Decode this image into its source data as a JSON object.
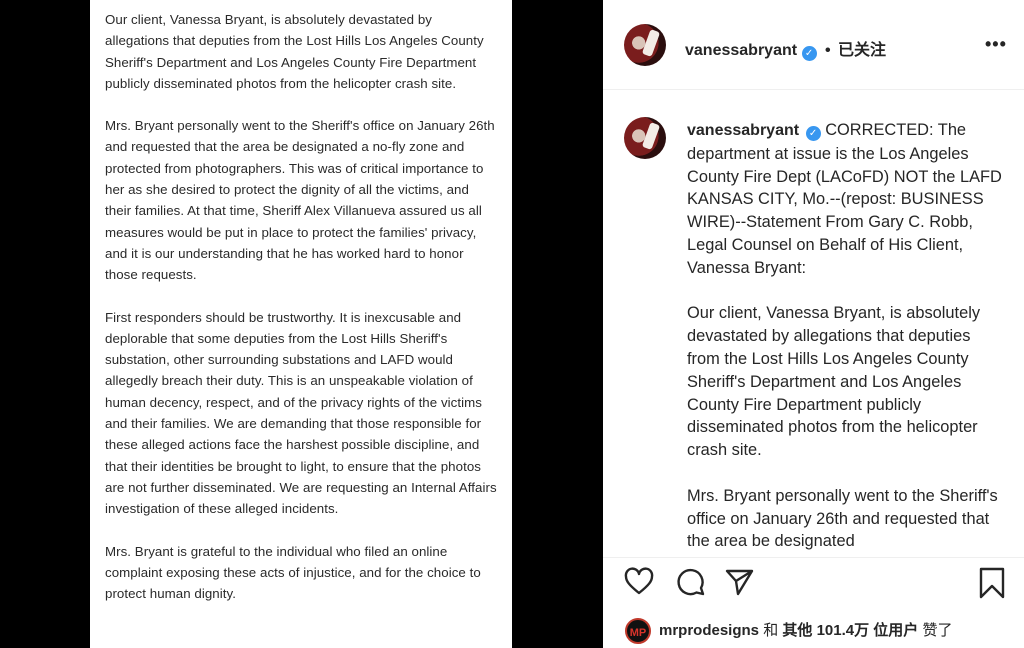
{
  "statement": {
    "paragraphs": [
      "Our client, Vanessa Bryant, is absolutely devastated by allegations that deputies from the Lost Hills Los Angeles County Sheriff's Department and Los Angeles County Fire Department publicly disseminated photos from the helicopter crash site.",
      "Mrs. Bryant personally went to the Sheriff's office on January 26th and requested that the area be designated a no-fly zone and protected from photographers. This was of critical importance to her as she desired to protect the dignity of all the victims, and their families. At that time, Sheriff Alex Villanueva assured us all measures would be put in place to protect the families' privacy, and it is our understanding that he has worked hard to honor those requests.",
      "First responders should be trustworthy. It is inexcusable and deplorable that some deputies from the Lost Hills Sheriff's substation, other surrounding substations and LAFD would allegedly breach their duty. This is an unspeakable violation of human decency, respect, and of the privacy rights of the victims and their families. We are demanding that those responsible for these alleged actions face the harshest possible discipline, and that their identities be brought to light, to ensure that the photos are not further disseminated. We are requesting an Internal Affairs investigation of these alleged incidents.",
      "Mrs. Bryant is grateful to the individual who filed an online complaint exposing these acts of injustice, and for the choice to protect human dignity."
    ]
  },
  "header": {
    "username": "vanessabryant",
    "verified_mark": "✓",
    "separator": "•",
    "follow_status": "已关注",
    "more_label": "•••"
  },
  "caption": {
    "username": "vanessabryant",
    "verified_mark": "✓",
    "first_text": "CORRECTED: The department at issue is the Los Angeles County Fire Dept (LACoFD) NOT the LAFD KANSAS CITY, Mo.--(repost: BUSINESS WIRE)--Statement From Gary C. Robb, Legal Counsel on Behalf of His Client, Vanessa Bryant:",
    "paragraph_2": "Our client, Vanessa Bryant, is absolutely devastated by allegations that deputies from the Lost Hills Los Angeles County Sheriff's Department and Los Angeles County Fire Department publicly disseminated photos from the helicopter crash site.",
    "paragraph_3": "Mrs. Bryant personally went to the Sheriff's office on January 26th and requested that the area be designated"
  },
  "icons": {
    "like": "heart-icon",
    "comment": "comment-icon",
    "share": "paper-plane-icon",
    "save": "bookmark-icon"
  },
  "likes": {
    "avatar_text": "MP",
    "liker": "mrprodesigns",
    "and": "和",
    "others_label": "其他",
    "count": "101.4万",
    "users_label": "位用户",
    "liked": "赞了"
  }
}
